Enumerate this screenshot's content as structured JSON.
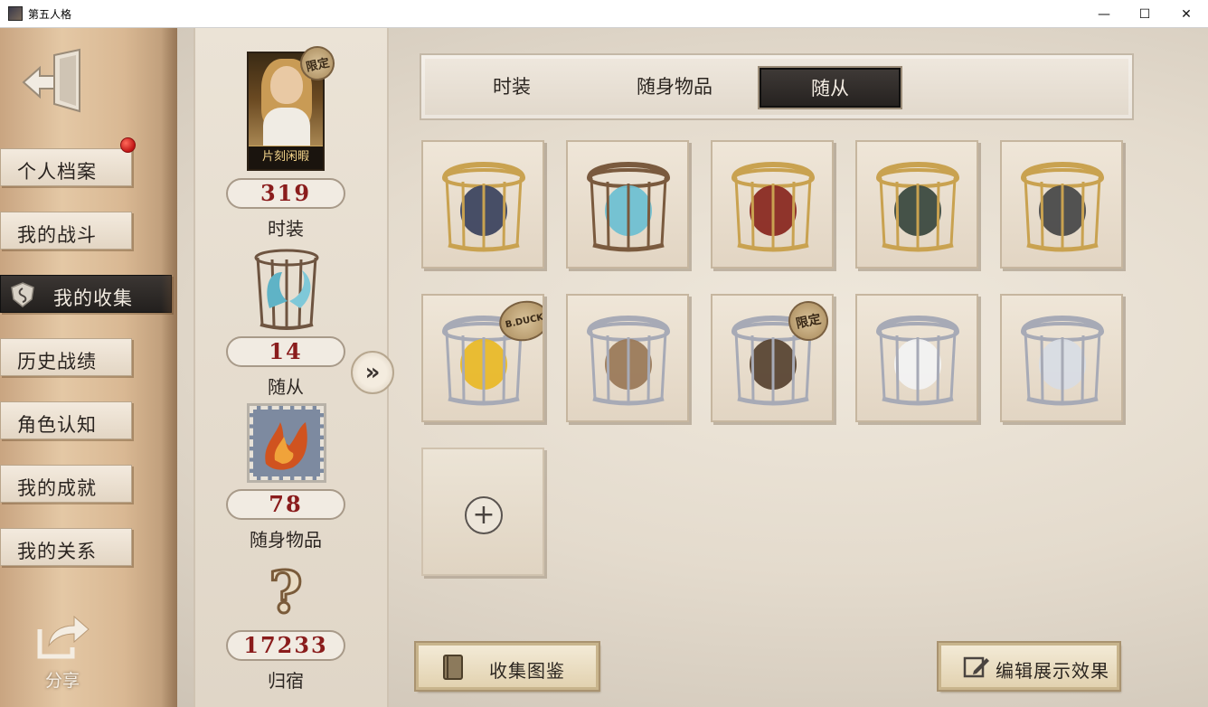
{
  "window": {
    "title": "第五人格",
    "minimize": "—",
    "maximize": "☐",
    "close": "✕"
  },
  "sidebar": {
    "items": [
      {
        "label": "个人档案"
      },
      {
        "label": "我的战斗"
      },
      {
        "label": "我的收集"
      },
      {
        "label": "历史战绩"
      },
      {
        "label": "角色认知"
      },
      {
        "label": "我的成就"
      },
      {
        "label": "我的关系"
      }
    ],
    "active_index": 2,
    "share_label": "分享"
  },
  "stats": {
    "portrait_name": "片刻闲暇",
    "limited": "限定",
    "costumes": {
      "count": "319",
      "label": "时装"
    },
    "pets": {
      "count": "14",
      "label": "随从"
    },
    "accessories": {
      "count": "78",
      "label": "随身物品"
    },
    "homes": {
      "count": "17233",
      "label": "归宿"
    },
    "question_mark": "?"
  },
  "tabs": [
    {
      "label": "时装"
    },
    {
      "label": "随身物品"
    },
    {
      "label": "随从"
    }
  ],
  "active_tab": 2,
  "pets": {
    "items": [
      {
        "name": "masked-raven-pet",
        "cage": "gold"
      },
      {
        "name": "blue-butterfly-pet",
        "cage": "bronze"
      },
      {
        "name": "red-chest-pet",
        "cage": "gold"
      },
      {
        "name": "antler-spirit-pet",
        "cage": "gold"
      },
      {
        "name": "steam-machine-pet",
        "cage": "gold"
      },
      {
        "name": "b-duck-pet",
        "cage": "silver",
        "badge": "B.DUCK"
      },
      {
        "name": "crowned-cat-pet",
        "cage": "silver"
      },
      {
        "name": "tree-cat-pet",
        "cage": "silver",
        "badge": "限定"
      },
      {
        "name": "tuxedo-cat-pet",
        "cage": "silver"
      },
      {
        "name": "white-horse-pet",
        "cage": "silver"
      }
    ],
    "add_symbol": "+"
  },
  "buttons": {
    "collection_book": "收集图鉴",
    "edit_display": "编辑展示效果"
  },
  "colors": {
    "count_red": "#8a1c1c",
    "gold_cage": "#c9a250",
    "silver_cage": "#a7aab6",
    "bronze_cage": "#7a5a3e"
  }
}
